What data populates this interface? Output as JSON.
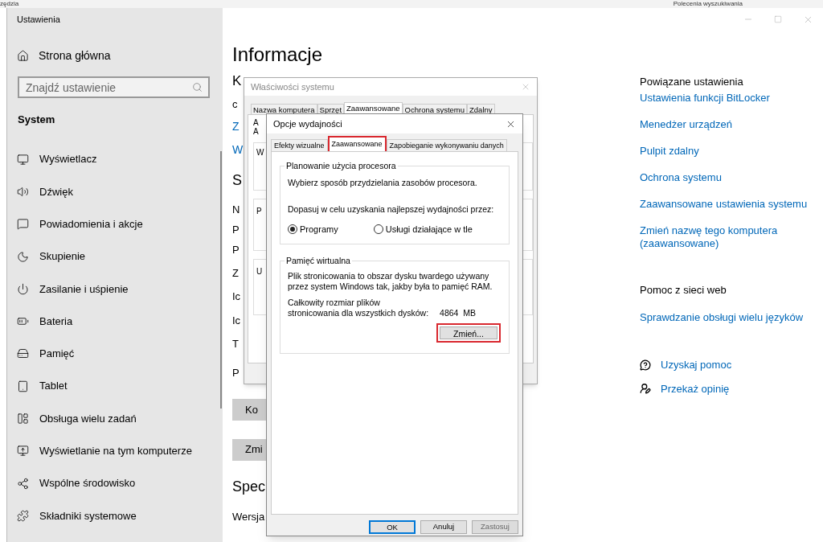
{
  "background_app": {
    "texts": [
      "zędzia",
      "Polecenia wyszukiwania"
    ]
  },
  "window": {
    "title": "Ustawienia"
  },
  "sidebar": {
    "home": "Strona główna",
    "search": {
      "placeholder": "Znajdź ustawienie"
    },
    "section": "System",
    "items": [
      {
        "label": "Wyświetlacz"
      },
      {
        "label": "Dźwięk"
      },
      {
        "label": "Powiadomienia i akcje"
      },
      {
        "label": "Skupienie"
      },
      {
        "label": "Zasilanie i uśpienie"
      },
      {
        "label": "Bateria"
      },
      {
        "label": "Pamięć"
      },
      {
        "label": "Tablet"
      },
      {
        "label": "Obsługa wielu zadań"
      },
      {
        "label": "Wyświetlanie na tym komputerze"
      },
      {
        "label": "Wspólne środowisko"
      },
      {
        "label": "Składniki systemowe"
      }
    ]
  },
  "main": {
    "title": "Informacje",
    "fragments": [
      {
        "kind": "subheading",
        "text": "K"
      },
      {
        "kind": "text",
        "text": "c"
      },
      {
        "kind": "link",
        "text": "Z"
      },
      {
        "kind": "link",
        "text": "W"
      },
      {
        "kind": "heading",
        "text": "S"
      },
      {
        "kind": "text",
        "text": "N"
      },
      {
        "kind": "text",
        "text": "P"
      },
      {
        "kind": "text",
        "text": "P"
      },
      {
        "kind": "text",
        "text": "Z"
      },
      {
        "kind": "text",
        "text": "Ic"
      },
      {
        "kind": "text",
        "text": "Ic"
      },
      {
        "kind": "text",
        "text": "T"
      },
      {
        "kind": "text",
        "text": "P"
      },
      {
        "kind": "button",
        "text": "Ko"
      },
      {
        "kind": "button",
        "text": "Zmi"
      },
      {
        "kind": "heading",
        "text": "Spec"
      },
      {
        "kind": "text",
        "text": "Wersja"
      }
    ]
  },
  "related": {
    "title": "Powiązane ustawienia",
    "links": [
      "Ustawienia funkcji BitLocker",
      "Menedżer urządzeń",
      "Pulpit zdalny",
      "Ochrona systemu",
      "Zaawansowane ustawienia systemu",
      "Zmień nazwę tego komputera (zaawansowane)"
    ]
  },
  "web_help": {
    "title": "Pomoc z sieci web",
    "links": [
      "Sprawdzanie obsługi wielu języków"
    ]
  },
  "help_links": [
    {
      "kind": "help",
      "label": "Uzyskaj pomoc"
    },
    {
      "kind": "feedback",
      "label": "Przekaż opinię"
    }
  ],
  "system_properties": {
    "title": "Właściwości systemu",
    "tabs": [
      {
        "label": "Nazwa komputera",
        "selected": false
      },
      {
        "label": "Sprzęt",
        "selected": false
      },
      {
        "label": "Zaawansowane",
        "selected": true
      },
      {
        "label": "Ochrona systemu",
        "selected": false
      },
      {
        "label": "Zdalny",
        "selected": false
      }
    ],
    "fragments": [
      "A",
      "A",
      "W",
      "P",
      "U"
    ]
  },
  "performance_options": {
    "title": "Opcje wydajności",
    "tabs": [
      {
        "label": "Efekty wizualne",
        "selected": false,
        "highlighted": false
      },
      {
        "label": "Zaawansowane",
        "selected": true,
        "highlighted": true
      },
      {
        "label": "Zapobieganie wykonywaniu danych",
        "selected": false,
        "highlighted": false
      }
    ],
    "processor": {
      "title": "Planowanie użycia procesora",
      "description": "Wybierz sposób przydzielania zasobów procesora.",
      "prompt": "Dopasuj w celu uzyskania najlepszej wydajności przez:",
      "options": [
        {
          "label": "Programy",
          "selected": true
        },
        {
          "label": "Usługi działające w tle",
          "selected": false
        }
      ]
    },
    "virtual_memory": {
      "title": "Pamięć wirtualna",
      "description": "Plik stronicowania to obszar dysku twardego używany przez system Windows tak, jakby była to pamięć RAM.",
      "size_label_1": "Całkowity rozmiar plików",
      "size_label_2": "stronicowania dla wszystkich dysków:",
      "size_value": "4864  MB",
      "button": {
        "label": "Zmień...",
        "highlighted": true
      }
    },
    "buttons": [
      {
        "label": "OK",
        "kind": "default",
        "disabled": false
      },
      {
        "label": "Anuluj",
        "kind": "normal",
        "disabled": false
      },
      {
        "label": "Zastosuj",
        "kind": "normal",
        "disabled": true
      }
    ]
  }
}
